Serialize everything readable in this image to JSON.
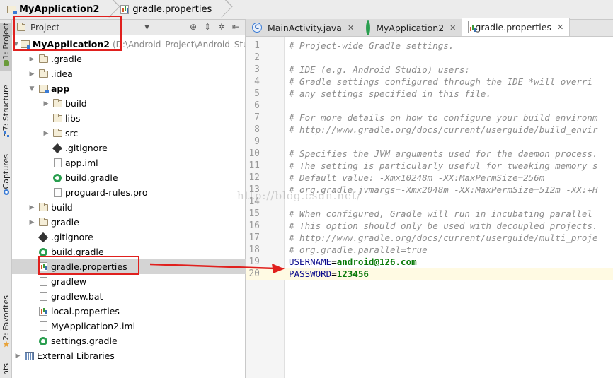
{
  "breadcrumb": [
    {
      "label": "MyApplication2",
      "bold": true
    },
    {
      "label": "gradle.properties",
      "bold": false
    }
  ],
  "left_strip": {
    "tabs": [
      {
        "label": "1: Project",
        "active": true
      },
      {
        "label": "7: Structure",
        "active": false
      },
      {
        "label": "Captures",
        "active": false
      },
      {
        "label": "2: Favorites",
        "active": false
      },
      {
        "label": "nts",
        "active": false
      }
    ]
  },
  "project_panel": {
    "view_mode": "Project",
    "tree": [
      {
        "indent": 0,
        "arrow": "down",
        "icon": "module",
        "name": "MyApplication2",
        "bold": true,
        "path": "(D:\\Android_Project\\Android_Stu"
      },
      {
        "indent": 1,
        "arrow": "right",
        "icon": "folder",
        "name": ".gradle"
      },
      {
        "indent": 1,
        "arrow": "right",
        "icon": "folder",
        "name": ".idea"
      },
      {
        "indent": 1,
        "arrow": "down",
        "icon": "module",
        "name": "app",
        "bold": true
      },
      {
        "indent": 2,
        "arrow": "right",
        "icon": "folder",
        "name": "build"
      },
      {
        "indent": 2,
        "arrow": "",
        "icon": "folder",
        "name": "libs"
      },
      {
        "indent": 2,
        "arrow": "right",
        "icon": "folder",
        "name": "src"
      },
      {
        "indent": 2,
        "arrow": "",
        "icon": "git",
        "name": ".gitignore"
      },
      {
        "indent": 2,
        "arrow": "",
        "icon": "file",
        "name": "app.iml"
      },
      {
        "indent": 2,
        "arrow": "",
        "icon": "gradle",
        "name": "build.gradle"
      },
      {
        "indent": 2,
        "arrow": "",
        "icon": "file",
        "name": "proguard-rules.pro"
      },
      {
        "indent": 1,
        "arrow": "right",
        "icon": "folder",
        "name": "build"
      },
      {
        "indent": 1,
        "arrow": "right",
        "icon": "folder",
        "name": "gradle"
      },
      {
        "indent": 1,
        "arrow": "",
        "icon": "git",
        "name": ".gitignore"
      },
      {
        "indent": 1,
        "arrow": "",
        "icon": "gradle",
        "name": "build.gradle"
      },
      {
        "indent": 1,
        "arrow": "",
        "icon": "props",
        "name": "gradle.properties",
        "selected": true
      },
      {
        "indent": 1,
        "arrow": "",
        "icon": "file",
        "name": "gradlew"
      },
      {
        "indent": 1,
        "arrow": "",
        "icon": "file",
        "name": "gradlew.bat"
      },
      {
        "indent": 1,
        "arrow": "",
        "icon": "props",
        "name": "local.properties"
      },
      {
        "indent": 1,
        "arrow": "",
        "icon": "file",
        "name": "MyApplication2.iml"
      },
      {
        "indent": 1,
        "arrow": "",
        "icon": "gradle",
        "name": "settings.gradle"
      },
      {
        "indent": 0,
        "arrow": "right",
        "icon": "lib",
        "name": "External Libraries"
      }
    ]
  },
  "editor": {
    "tabs": [
      {
        "label": "MainActivity.java",
        "icon": "c-icon",
        "active": false
      },
      {
        "label": "MyApplication2",
        "icon": "gradle",
        "active": false
      },
      {
        "label": "gradle.properties",
        "icon": "props",
        "active": true
      }
    ],
    "lines": [
      {
        "n": "1",
        "type": "comment",
        "text": "# Project-wide Gradle settings."
      },
      {
        "n": "2",
        "type": "blank",
        "text": ""
      },
      {
        "n": "3",
        "type": "comment",
        "text": "# IDE (e.g. Android Studio) users:"
      },
      {
        "n": "4",
        "type": "comment",
        "text": "# Gradle settings configured through the IDE *will overri"
      },
      {
        "n": "5",
        "type": "comment",
        "text": "# any settings specified in this file."
      },
      {
        "n": "6",
        "type": "blank",
        "text": ""
      },
      {
        "n": "7",
        "type": "comment",
        "text": "# For more details on how to configure your build environm"
      },
      {
        "n": "8",
        "type": "comment",
        "text": "# http://www.gradle.org/docs/current/userguide/build_envir"
      },
      {
        "n": "9",
        "type": "blank",
        "text": ""
      },
      {
        "n": "10",
        "type": "comment",
        "text": "# Specifies the JVM arguments used for the daemon process."
      },
      {
        "n": "11",
        "type": "comment",
        "text": "# The setting is particularly useful for tweaking memory s"
      },
      {
        "n": "12",
        "type": "comment",
        "text": "# Default value: -Xmx10248m -XX:MaxPermSize=256m"
      },
      {
        "n": "13",
        "type": "comment",
        "text": "# org.gradle.jvmargs=-Xmx2048m -XX:MaxPermSize=512m -XX:+H"
      },
      {
        "n": "14",
        "type": "blank",
        "text": ""
      },
      {
        "n": "15",
        "type": "comment",
        "text": "# When configured, Gradle will run in incubating parallel"
      },
      {
        "n": "16",
        "type": "comment",
        "text": "# This option should only be used with decoupled projects."
      },
      {
        "n": "17",
        "type": "comment",
        "text": "# http://www.gradle.org/docs/current/userguide/multi_proje"
      },
      {
        "n": "18",
        "type": "comment",
        "text": "# org.gradle.parallel=true"
      },
      {
        "n": "19",
        "type": "prop",
        "key": "USERNAME",
        "eq": "=",
        "value": "android@126.com"
      },
      {
        "n": "20",
        "type": "prop",
        "key": "PASSWORD",
        "eq": "=",
        "value": "123456",
        "current": true
      }
    ]
  },
  "watermark": "http://blog.csdn.net/",
  "colors": {
    "annotation_red": "#e0201e",
    "comment": "#8c8c8c",
    "key": "#0b0b8c",
    "value": "#0a7a0a",
    "current_line": "#fffae3"
  }
}
